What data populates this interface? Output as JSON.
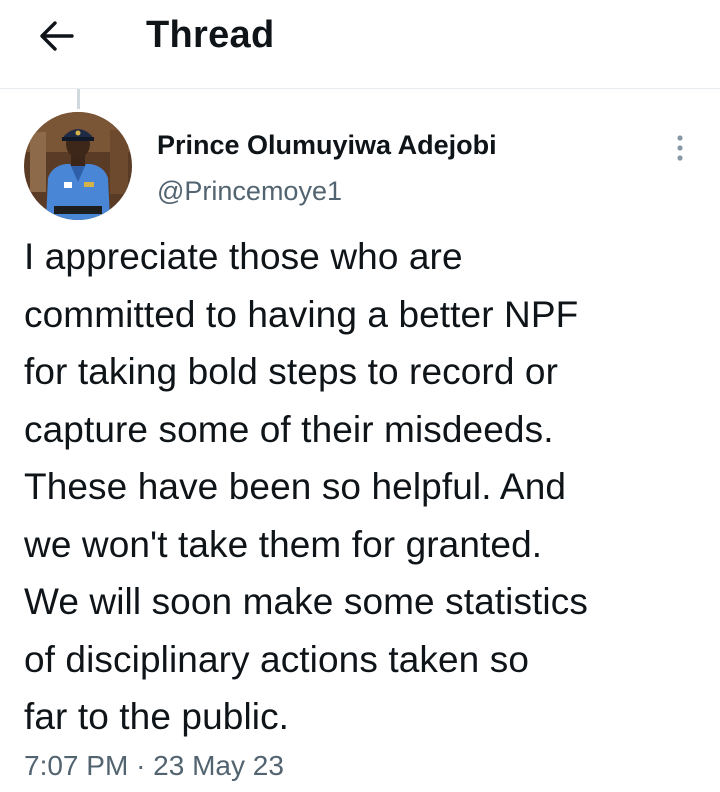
{
  "header": {
    "title": "Thread",
    "back_icon": "arrow-left-icon"
  },
  "tweet": {
    "author": {
      "name": "Prince Olumuyiwa Adejobi",
      "handle": "@Princemoye1",
      "avatar": "police-officer-avatar"
    },
    "more_icon": "vertical-dots-icon",
    "text": "I appreciate those who are\ncommitted to having a better NPF\nfor taking bold steps to record or\ncapture some of their misdeeds.\nThese have been so helpful. And\nwe won't take them for granted.\nWe will soon make some statistics\nof disciplinary actions taken so\nfar to the public.",
    "time": "7:07 PM",
    "separator": "·",
    "date": "23 May 23"
  },
  "colors": {
    "text": "#0f1419",
    "secondary": "#536471",
    "divider": "#e6ecf0",
    "thread_line": "#cfd9de"
  }
}
